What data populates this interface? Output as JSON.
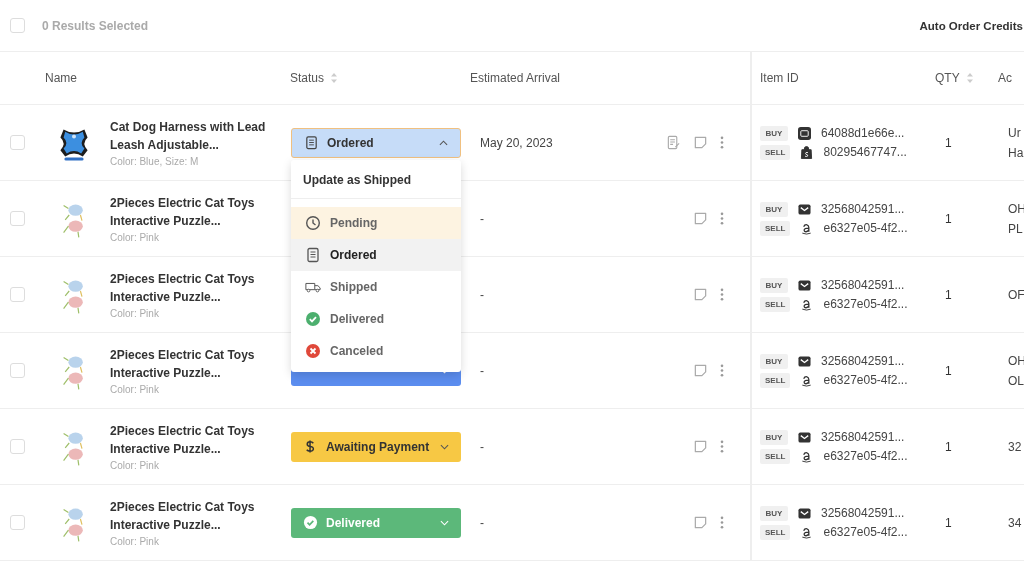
{
  "toolbar": {
    "selected_count": "0 Results Selected",
    "select_all_checked": false,
    "credits": "Auto Order Credits"
  },
  "columns": [
    {
      "label": "Name",
      "sortable": false
    },
    {
      "label": "Status",
      "sortable": true
    },
    {
      "label": "Estimated Arrival",
      "sortable": false
    },
    {
      "label": "Item ID",
      "sortable": false
    },
    {
      "label": "QTY",
      "sortable": true
    },
    {
      "label": "Ac",
      "sortable": false
    }
  ],
  "rows": [
    {
      "checked": false,
      "image": {
        "kind": "harness"
      },
      "name": "Cat Dog Harness with Lead Leash Adjustable...",
      "variant": "Color: Blue, Size: M",
      "status": {
        "kind": "ordered",
        "label": "Ordered",
        "open": true
      },
      "arrival": "May 20, 2023",
      "invoice_icon": true,
      "buy": {
        "badge": "BUY",
        "kind": "ds",
        "id": "64088d1e66e..."
      },
      "sell": {
        "badge": "SELL",
        "kind": "shopify",
        "id": "80295467747..."
      },
      "qty": "1",
      "column_6": [
        "Ur",
        "Ha"
      ]
    },
    {
      "checked": false,
      "image": {
        "kind": "toys"
      },
      "name": "2Pieces Electric Cat Toys Interactive Puzzle...",
      "variant": "Color: Pink",
      "arrival": "-",
      "invoice_icon": false,
      "buy": {
        "badge": "BUY",
        "kind": "mail",
        "id": "32568042591..."
      },
      "sell": {
        "badge": "SELL",
        "kind": "amazon",
        "id": "e6327e05-4f2..."
      },
      "qty": "1",
      "column_6": [
        "OH",
        "PL"
      ]
    },
    {
      "checked": false,
      "image": {
        "kind": "toys"
      },
      "name": "2Pieces Electric Cat Toys Interactive Puzzle...",
      "variant": "Color: Pink",
      "arrival": "-",
      "invoice_icon": false,
      "buy": {
        "badge": "BUY",
        "kind": "mail",
        "id": "32568042591..."
      },
      "sell": {
        "badge": "SELL",
        "kind": "amazon",
        "id": "e6327e05-4f2..."
      },
      "qty": "1",
      "column_6": [
        "OF"
      ]
    },
    {
      "checked": false,
      "image": {
        "kind": "toys"
      },
      "name": "2Pieces Electric Cat Toys Interactive Puzzle...",
      "variant": "Color: Pink",
      "status": {
        "kind": "shipped",
        "open": false
      },
      "arrival": "-",
      "invoice_icon": false,
      "buy": {
        "badge": "BUY",
        "kind": "mail",
        "id": "32568042591..."
      },
      "sell": {
        "badge": "SELL",
        "kind": "amazon",
        "id": "e6327e05-4f2..."
      },
      "qty": "1",
      "column_6": [
        "OH",
        "OL"
      ]
    },
    {
      "checked": false,
      "image": {
        "kind": "toys"
      },
      "name": "2Pieces Electric Cat Toys Interactive Puzzle...",
      "variant": "Color: Pink",
      "status": {
        "kind": "awaiting",
        "label": "Awaiting Payment",
        "open": false
      },
      "arrival": "-",
      "invoice_icon": false,
      "buy": {
        "badge": "BUY",
        "kind": "mail",
        "id": "32568042591..."
      },
      "sell": {
        "badge": "SELL",
        "kind": "amazon",
        "id": "e6327e05-4f2..."
      },
      "qty": "1",
      "column_6": [
        "32"
      ]
    },
    {
      "checked": false,
      "image": {
        "kind": "toys"
      },
      "name": "2Pieces Electric Cat Toys Interactive Puzzle...",
      "variant": "Color: Pink",
      "status": {
        "kind": "delivered",
        "label": "Delivered",
        "open": false
      },
      "arrival": "-",
      "invoice_icon": false,
      "buy": {
        "badge": "BUY",
        "kind": "mail",
        "id": "32568042591..."
      },
      "sell": {
        "badge": "SELL",
        "kind": "amazon",
        "id": "e6327e05-4f2..."
      },
      "qty": "1",
      "column_6": [
        "34"
      ]
    }
  ],
  "status_menu": {
    "title": "Update as Shipped",
    "items": [
      {
        "kind": "pending",
        "label": "Pending",
        "selected": false,
        "hovered": true
      },
      {
        "kind": "ordered",
        "label": "Ordered",
        "selected": true,
        "hovered": false
      },
      {
        "kind": "shipped",
        "label": "Shipped",
        "selected": false,
        "hovered": false
      },
      {
        "kind": "delivered",
        "label": "Delivered",
        "selected": false,
        "hovered": false
      },
      {
        "kind": "canceled",
        "label": "Canceled",
        "selected": false,
        "hovered": false
      }
    ]
  }
}
